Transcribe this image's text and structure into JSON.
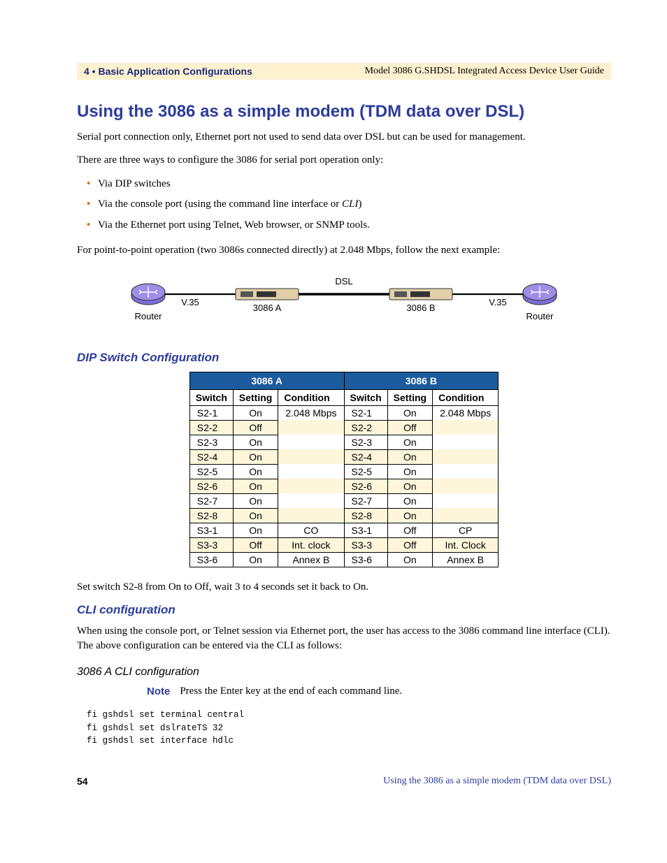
{
  "header": {
    "chapter": "4 • Basic Application Configurations",
    "doc_title": "Model 3086 G.SHDSL Integrated Access Device User Guide"
  },
  "heading": "Using the 3086 as a simple modem (TDM data over DSL)",
  "intro1": "Serial port connection only, Ethernet port not used to send data over DSL but can be used for management.",
  "intro2": "There are three ways to configure the 3086 for serial port operation only:",
  "bullets": {
    "b1": "Via DIP switches",
    "b2_pre": "Via the console port (using the command line interface or ",
    "b2_em": "CLI",
    "b2_post": ")",
    "b3": "Via the Ethernet port using Telnet, Web browser, or SNMP tools."
  },
  "intro3": "For point-to-point operation (two 3086s connected directly) at 2.048 Mbps, follow the next example:",
  "diagram": {
    "router_left": "Router",
    "router_right": "Router",
    "v35_left": "V.35",
    "v35_right": "V.35",
    "dsl": "DSL",
    "dev_a": "3086 A",
    "dev_b": "3086 B"
  },
  "dip_heading": "DIP Switch Configuration",
  "table": {
    "group_a": "3086 A",
    "group_b": "3086 B",
    "cols": {
      "switch": "Switch",
      "setting": "Setting",
      "condition": "Condition"
    },
    "rows": [
      {
        "a_sw": "S2-1",
        "a_set": "On",
        "a_cond": "2.048 Mbps",
        "b_sw": "S2-1",
        "b_set": "On",
        "b_cond": "2.048 Mbps",
        "alt": false
      },
      {
        "a_sw": "S2-2",
        "a_set": "Off",
        "a_cond": "",
        "b_sw": "S2-2",
        "b_set": "Off",
        "b_cond": "",
        "alt": true
      },
      {
        "a_sw": "S2-3",
        "a_set": "On",
        "a_cond": "",
        "b_sw": "S2-3",
        "b_set": "On",
        "b_cond": "",
        "alt": false
      },
      {
        "a_sw": "S2-4",
        "a_set": "On",
        "a_cond": "",
        "b_sw": "S2-4",
        "b_set": "On",
        "b_cond": "",
        "alt": true
      },
      {
        "a_sw": "S2-5",
        "a_set": "On",
        "a_cond": "",
        "b_sw": "S2-5",
        "b_set": "On",
        "b_cond": "",
        "alt": false
      },
      {
        "a_sw": "S2-6",
        "a_set": "On",
        "a_cond": "",
        "b_sw": "S2-6",
        "b_set": "On",
        "b_cond": "",
        "alt": true
      },
      {
        "a_sw": "S2-7",
        "a_set": "On",
        "a_cond": "",
        "b_sw": "S2-7",
        "b_set": "On",
        "b_cond": "",
        "alt": false
      },
      {
        "a_sw": "S2-8",
        "a_set": "On",
        "a_cond": "",
        "b_sw": "S2-8",
        "b_set": "On",
        "b_cond": "",
        "alt": true
      },
      {
        "a_sw": "S3-1",
        "a_set": "On",
        "a_cond": "CO",
        "b_sw": "S3-1",
        "b_set": "Off",
        "b_cond": "CP",
        "alt": false
      },
      {
        "a_sw": "S3-3",
        "a_set": "Off",
        "a_cond": "Int. clock",
        "b_sw": "S3-3",
        "b_set": "Off",
        "b_cond": "Int. Clock",
        "alt": true
      },
      {
        "a_sw": "S3-6",
        "a_set": "On",
        "a_cond": "Annex B",
        "b_sw": "S3-6",
        "b_set": "On",
        "b_cond": "Annex B",
        "alt": false
      }
    ]
  },
  "after_table": "Set switch S2-8 from On to Off, wait 3 to 4 seconds set it back to On.",
  "cli_heading": "CLI configuration",
  "cli_intro": "When using the console port, or Telnet session via Ethernet port, the user has access to the 3086 command line interface (CLI). The above configuration can be entered via the CLI as follows:",
  "cli_a_heading": "3086 A CLI configuration",
  "note": {
    "label": "Note",
    "text": "Press the Enter key at the end of each command line."
  },
  "cli_lines": "fi gshdsl set terminal central\nfi gshdsl set dslrateTS 32\nfi gshdsl set interface hdlc",
  "footer": {
    "page": "54",
    "section": "Using the 3086 as a simple modem (TDM data over DSL)"
  }
}
